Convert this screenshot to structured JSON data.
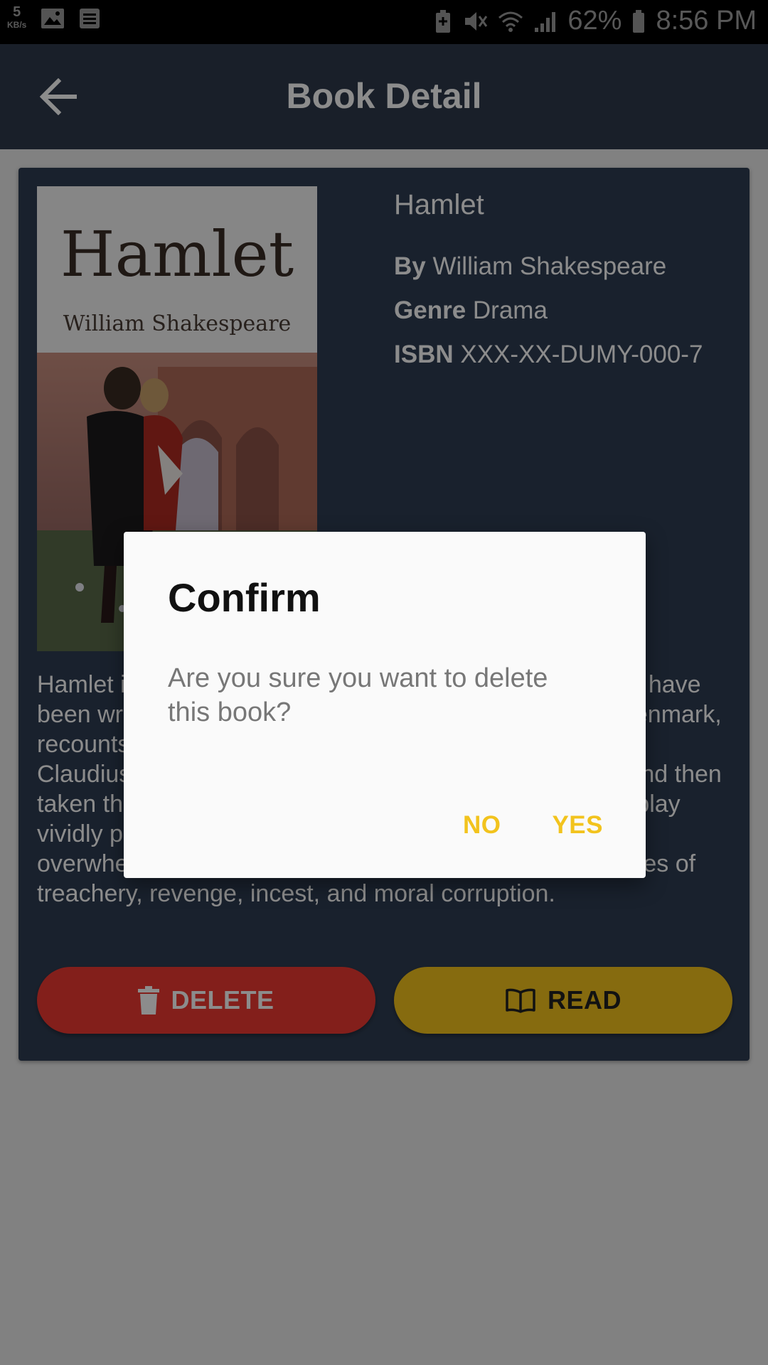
{
  "status_bar": {
    "speed_value": "5",
    "speed_unit": "KB/s",
    "battery": "62%",
    "time": "8:56 PM"
  },
  "appbar": {
    "title": "Book Detail"
  },
  "book": {
    "title": "Hamlet",
    "cover_title": "Hamlet",
    "cover_author": "William Shakespeare",
    "by_label": "By",
    "author": "William Shakespeare",
    "genre_label": "Genre",
    "genre": "Drama",
    "isbn_label": "ISBN",
    "isbn": "XXX-XX-DUMY-000-7",
    "description": "Hamlet is a tragedy by William Shakespeare, believed to have been written between 1599 and 1601. The play, set in Denmark, recounts how Prince Hamlet exacts revenge on his uncle Claudius, who has murdered Hamlet's father, the King, and then taken the throne and married Gertrude, his mother. The play vividly portrays both true and feigned madness—from overwhelming grief to seething rage—and explores themes of treachery, revenge, incest, and moral corruption."
  },
  "actions": {
    "delete_label": "DELETE",
    "read_label": "READ"
  },
  "dialog": {
    "title": "Confirm",
    "message": "Are you sure you want to delete this book?",
    "no_label": "NO",
    "yes_label": "YES"
  },
  "colors": {
    "appbar": "#2e3a4c",
    "card": "#2f3d52",
    "delete": "#ef3a32",
    "read": "#f4c31d",
    "dialog_action": "#f2c31d"
  }
}
